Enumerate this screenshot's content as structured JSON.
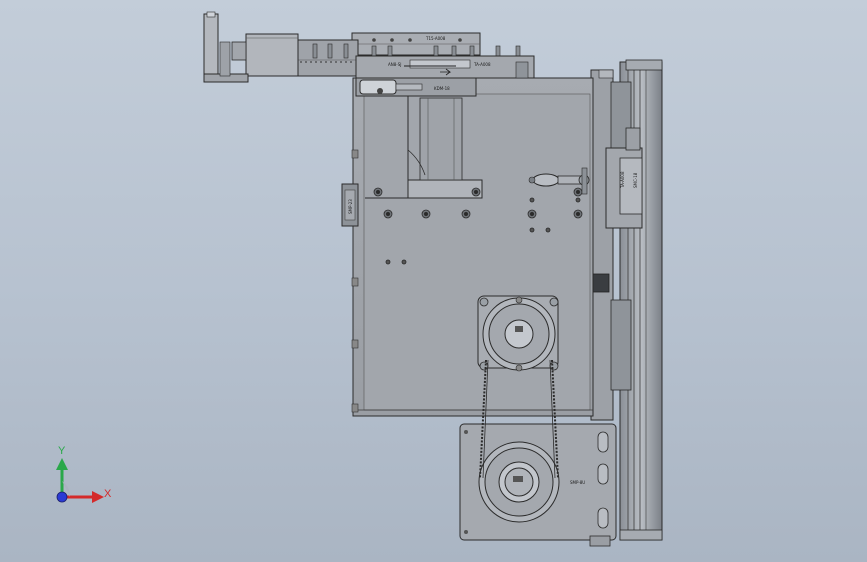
{
  "viewport": {
    "name": "solidworks-graphics-area",
    "background_top": "#c3cdd9",
    "background_bottom": "#aab5c3"
  },
  "part_labels": {
    "top_bar_label": "T15-A008",
    "sensor_label_a": "AN8-SJ",
    "bracket_label_b": "TA-A008",
    "cylinder_label": "KDM-18",
    "left_block_label": "SMP-23",
    "right_block_label": "TA-A008",
    "right_block_label2": "SMC-18",
    "motor_plate_label": "SMP-8U"
  },
  "triad": {
    "y_label": "Y",
    "x_label": "X",
    "y_color": "#2aa84a",
    "x_color": "#d42a2a",
    "z_color": "#2a3ad4"
  }
}
